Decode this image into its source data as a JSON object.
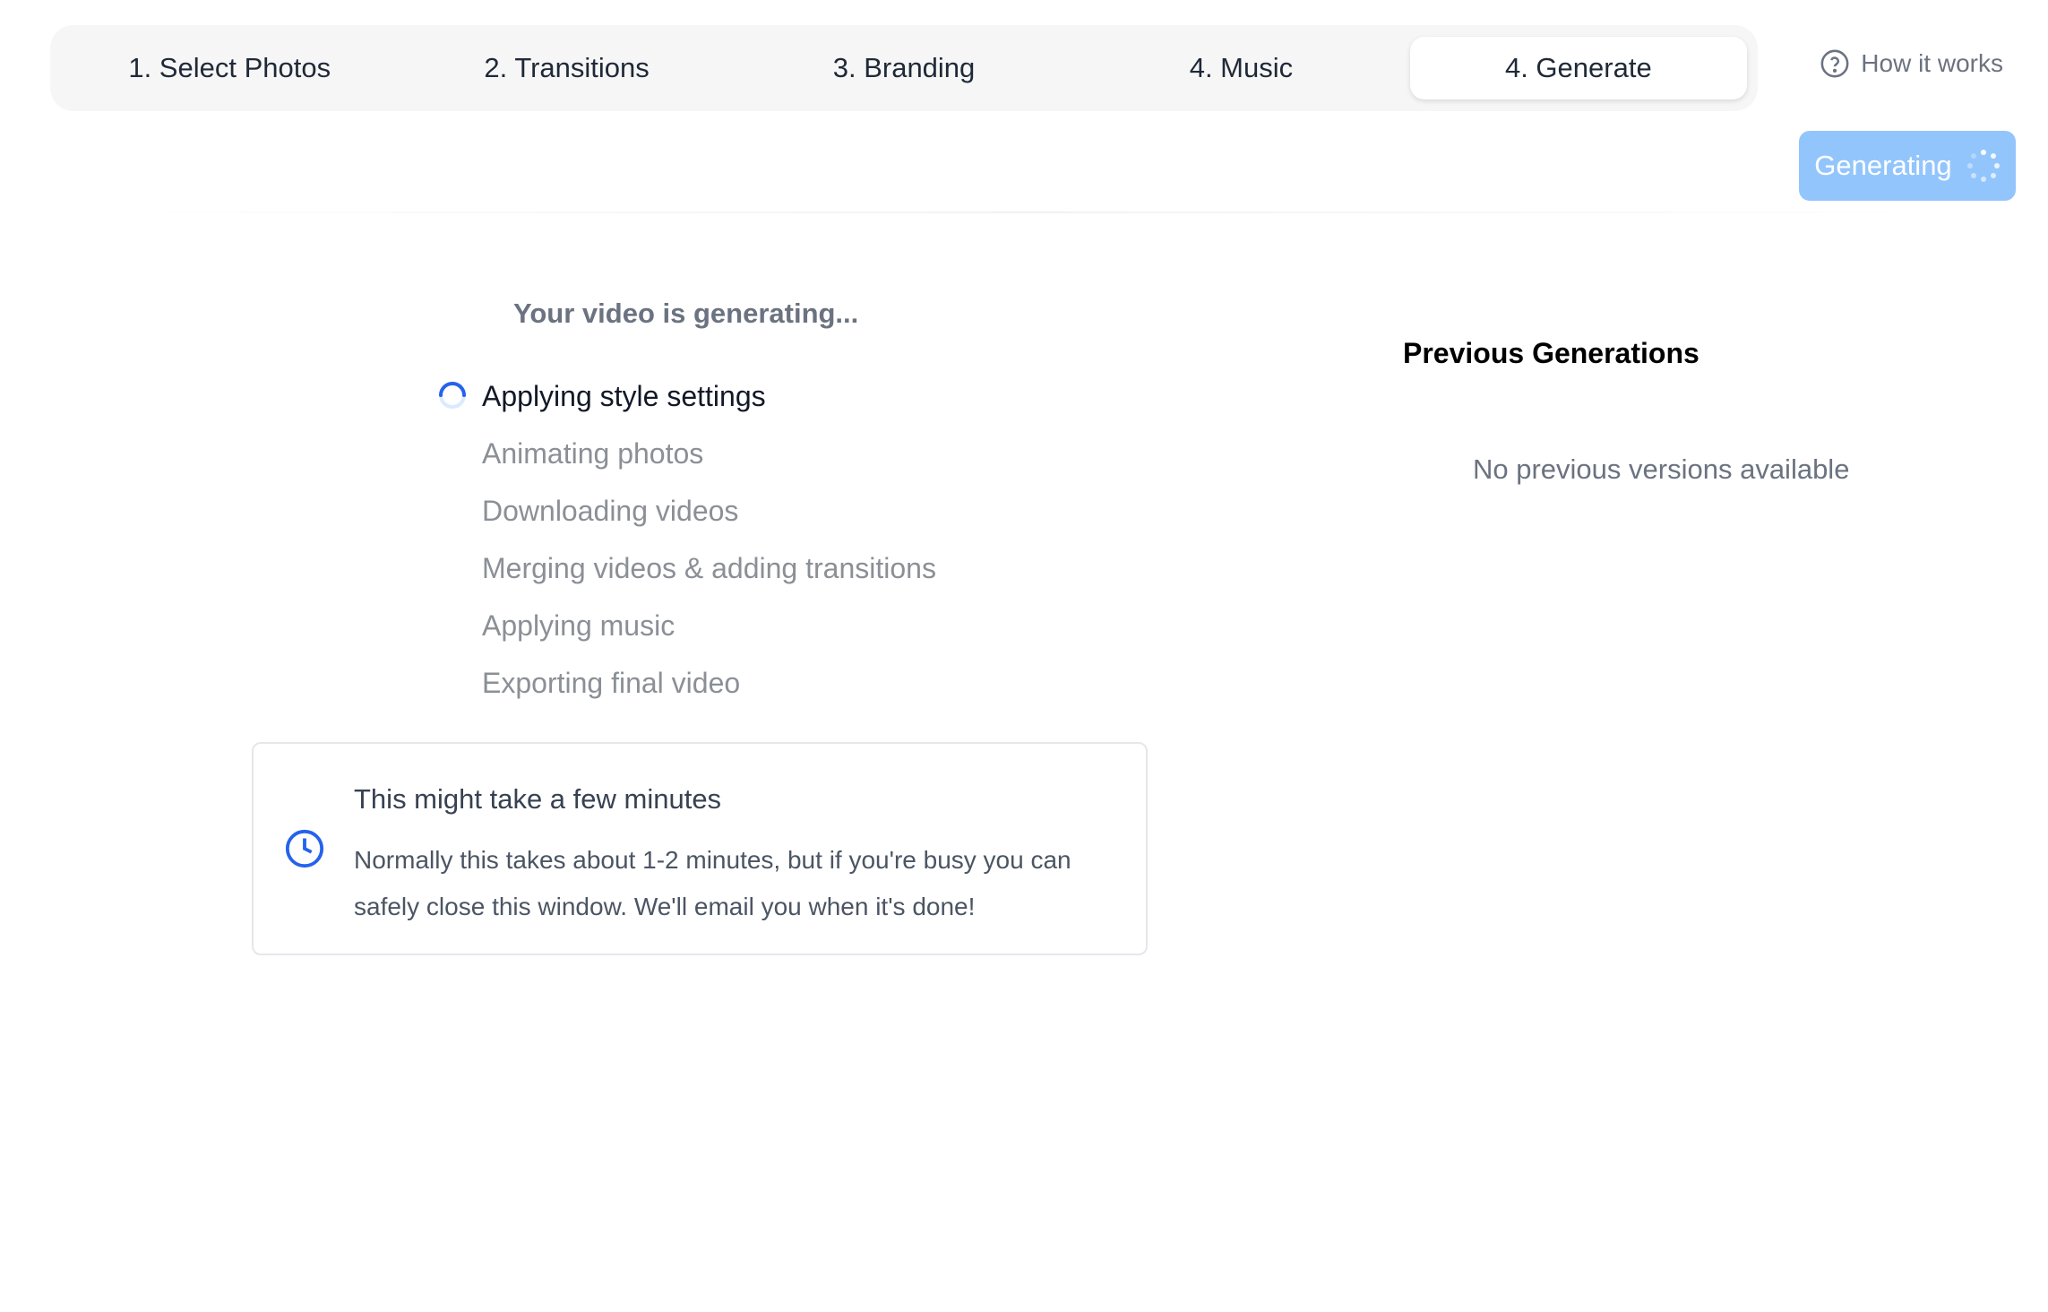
{
  "steps": [
    {
      "label": "1. Select Photos",
      "active": false
    },
    {
      "label": "2. Transitions",
      "active": false
    },
    {
      "label": "3. Branding",
      "active": false
    },
    {
      "label": "4. Music",
      "active": false
    },
    {
      "label": "4. Generate",
      "active": true
    }
  ],
  "header": {
    "how_it_works_label": "How it works",
    "how_it_works_icon": "question-circle-icon",
    "generating_label": "Generating",
    "generating_icon": "spinner-dots-icon"
  },
  "generation": {
    "title": "Your video is generating...",
    "items": [
      {
        "label": "Applying style settings",
        "status": "in-progress"
      },
      {
        "label": "Animating photos",
        "status": "pending"
      },
      {
        "label": "Downloading videos",
        "status": "pending"
      },
      {
        "label": "Merging videos & adding transitions",
        "status": "pending"
      },
      {
        "label": "Applying music",
        "status": "pending"
      },
      {
        "label": "Exporting final video",
        "status": "pending"
      }
    ],
    "info_card": {
      "icon": "clock-icon",
      "title": "This might take a few minutes",
      "text": "Normally this takes about 1-2 minutes, but if you're busy you can safely close this window. We'll email you when it's done!"
    }
  },
  "previous_generations": {
    "title": "Previous Generations",
    "empty_message": "No previous versions available"
  },
  "colors": {
    "accent": "#2563eb",
    "button_disabled": "#93c5fd",
    "muted_text": "#6b7280"
  }
}
